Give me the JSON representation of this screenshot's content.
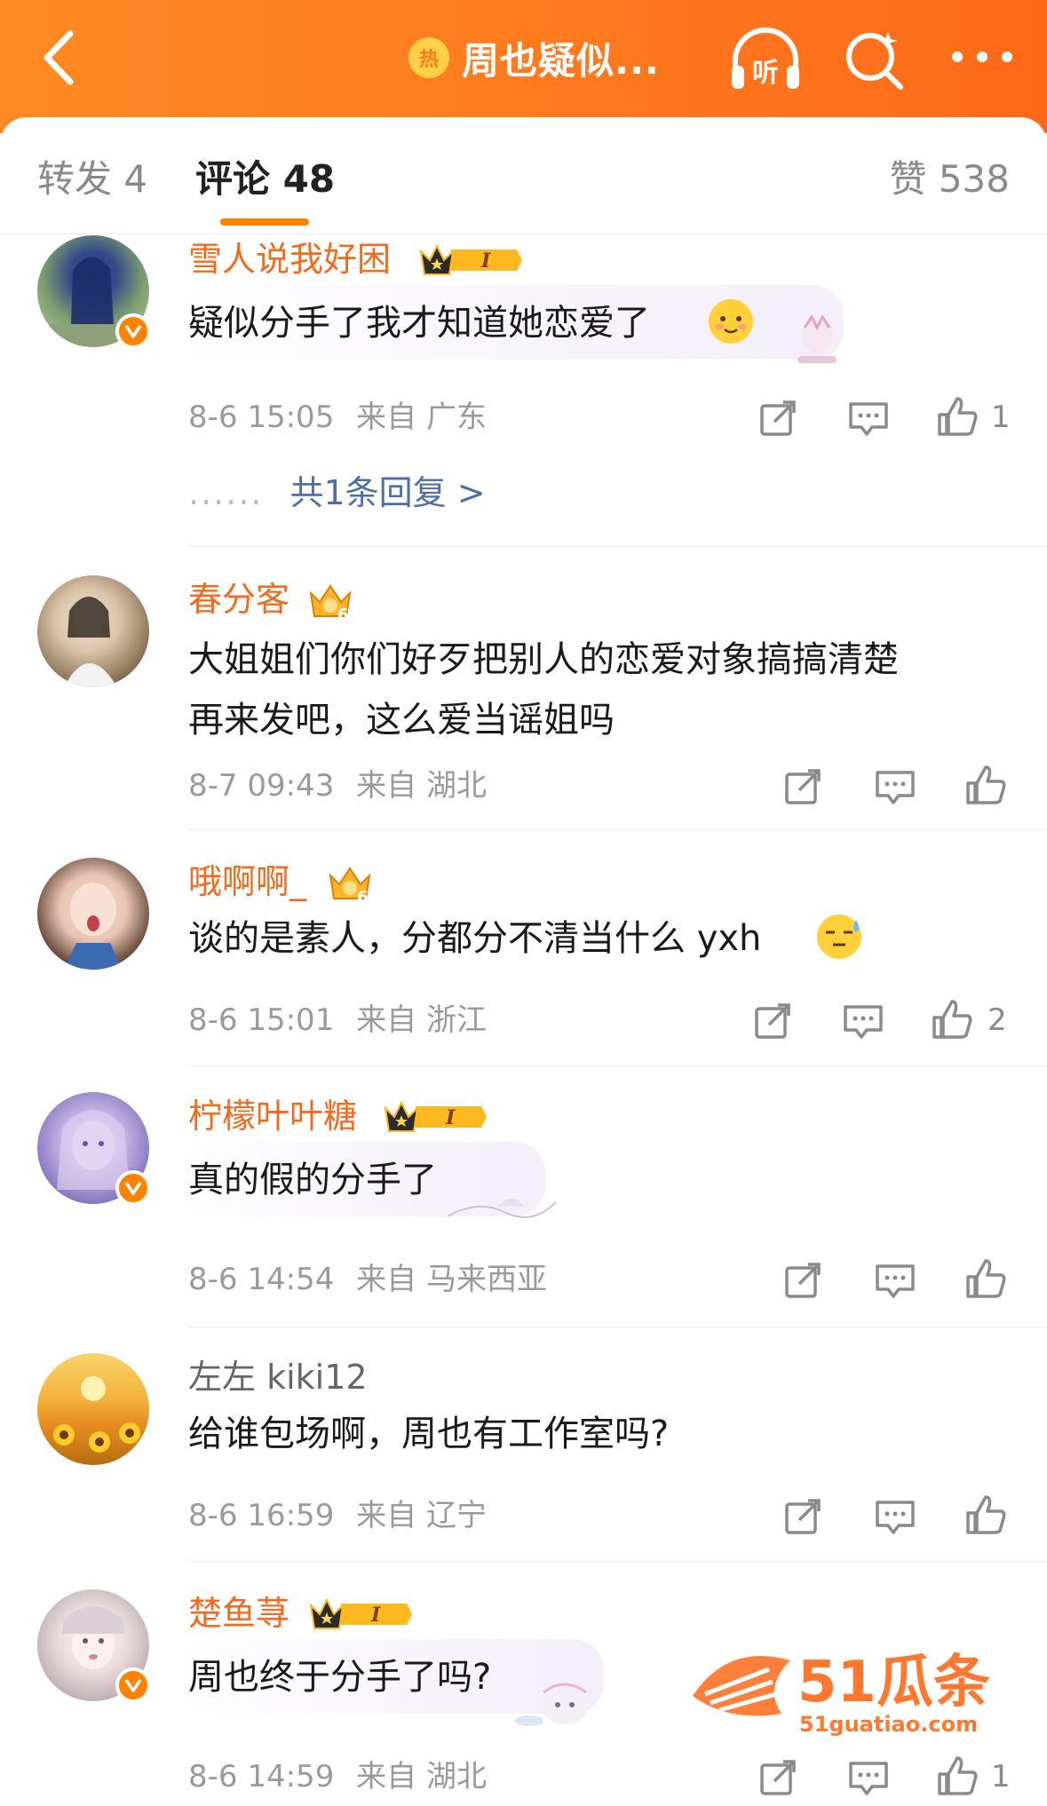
{
  "header": {
    "title": "周也疑似...",
    "hot_badge": "热",
    "listen_label": "听"
  },
  "tabs": {
    "forward": "转发 4",
    "comments": "评论 48",
    "likes": "赞 538"
  },
  "comments": [
    {
      "user": "雪人说我好困",
      "vip_level": "I",
      "verified": true,
      "text": "疑似分手了我才知道她恋爱了",
      "time": "8-6 15:05",
      "location": "来自 广东",
      "likes": "1",
      "reply_text": "共1条回复 >",
      "reply_dots": "......"
    },
    {
      "user": "春分客",
      "vip_level": "6",
      "verified": false,
      "text_line1": "大姐姐们你们好歹把别人的恋爱对象搞搞清楚",
      "text_line2": "再来发吧，这么爱当谣姐吗",
      "time": "8-7 09:43",
      "location": "来自 湖北",
      "likes": ""
    },
    {
      "user": "哦啊啊_",
      "vip_level": "6",
      "verified": false,
      "text": "谈的是素人，分都分不清当什么 yxh",
      "time": "8-6 15:01",
      "location": "来自 浙江",
      "likes": "2"
    },
    {
      "user": "柠檬叶叶糖",
      "vip_level": "I",
      "verified": true,
      "text": "真的假的分手了",
      "time": "8-6 14:54",
      "location": "来自 马来西亚",
      "likes": ""
    },
    {
      "user": "左左 kiki12",
      "verified": false,
      "text": "给谁包场啊，周也有工作室吗?",
      "time": "8-6 16:59",
      "location": "来自 辽宁",
      "likes": ""
    },
    {
      "user": "楚鱼荨",
      "vip_level": "I",
      "verified": true,
      "text": "周也终于分手了吗?",
      "time": "8-6 14:59",
      "location": "来自 湖北",
      "likes": "1"
    }
  ],
  "watermark": {
    "brand": "51瓜条",
    "url": "51guatiao.com"
  },
  "colors": {
    "header": "#ff7a1e",
    "accent": "#ff8200",
    "username_vip": "#f26b1d",
    "link": "#4d6ea6",
    "meta": "#9a9a9a"
  }
}
